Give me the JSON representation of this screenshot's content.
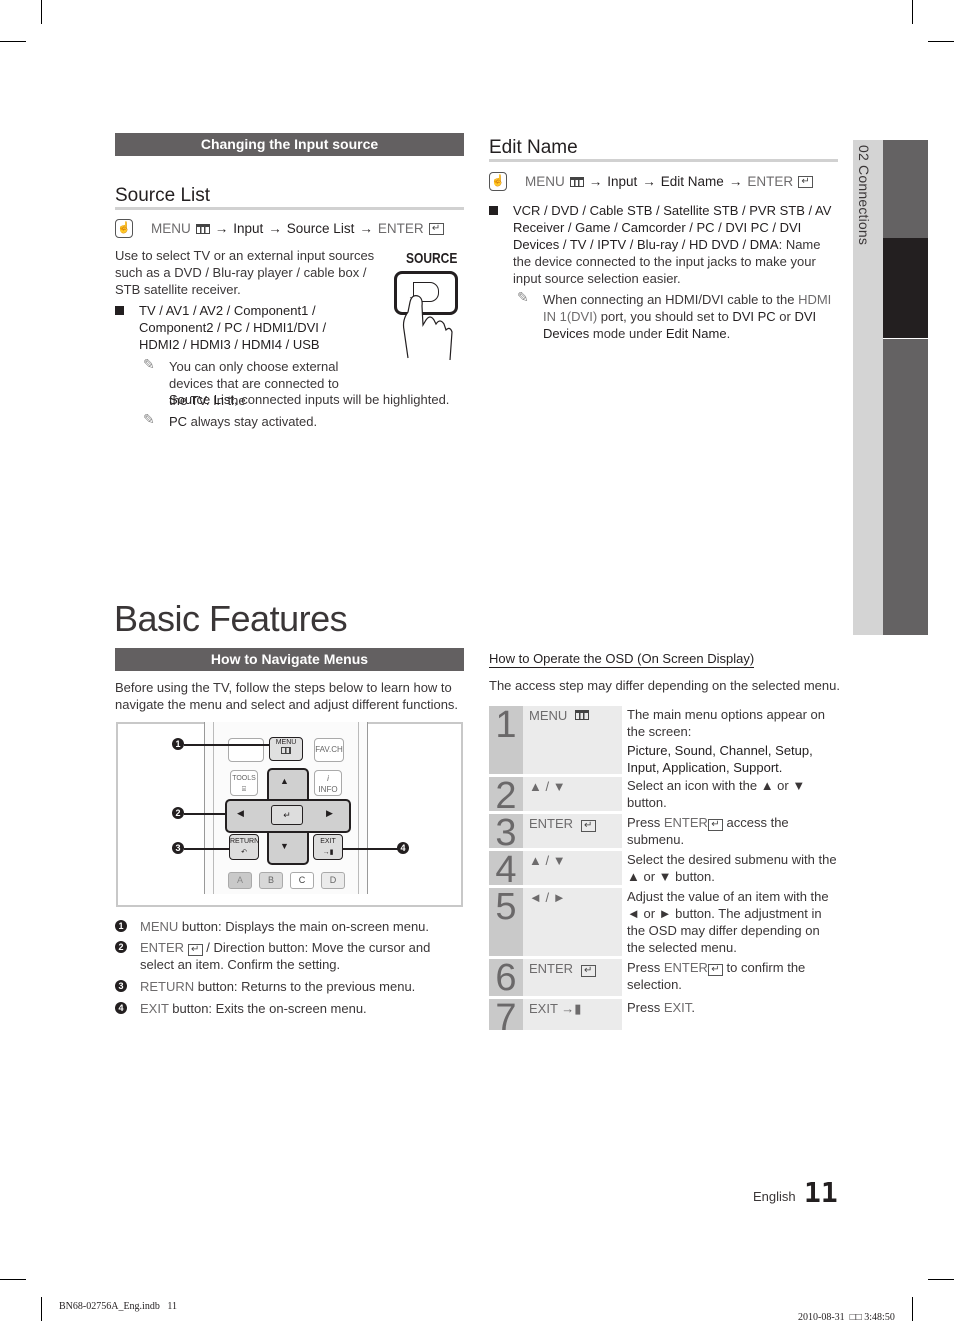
{
  "page": {
    "language": "English",
    "page_number": "11",
    "side_tab_label": "02  Connections"
  },
  "changing_input": {
    "header": "Changing the Input source",
    "source_list": {
      "title": "Source List",
      "path": {
        "menu": "MENU",
        "input": "Input",
        "item": "Source List",
        "enter": "ENTER"
      },
      "description": "Use to select TV or an external input sources such as a DVD / Blu-ray player / cable box / STB satellite receiver.",
      "button_label": "SOURCE",
      "bullet": "TV / AV1 / AV2 / Component1 / Component2 / PC / HDMI1/DVI / HDMI2 / HDMI3 / HDMI4 / USB",
      "note1_a": "You can only choose external devices that are connected to the TV. In the ",
      "note1_bold": "Source List",
      "note1_b": ", connected inputs will be highlighted.",
      "note2_bold": "PC",
      "note2_rest": " always stay activated."
    }
  },
  "edit_name": {
    "title": "Edit Name",
    "path": {
      "menu": "MENU",
      "input": "Input",
      "item": "Edit Name",
      "enter": "ENTER"
    },
    "bullet_bold": "VCR / DVD / Cable STB / Satellite STB / PVR STB / AV Receiver / Game / Camcorder / PC / DVI PC / DVI Devices / TV / IPTV / Blu-ray / HD DVD / DMA",
    "bullet_rest": ": Name the device connected to the input jacks to make your input source selection easier.",
    "note_a": "When connecting an HDMI/DVI cable to the ",
    "note_port": "HDMI IN 1(DVI)",
    "note_b": " port, you should set to ",
    "note_bold1": "DVI PC",
    "note_c": " or ",
    "note_bold2": "DVI Devices",
    "note_d": " mode under ",
    "note_bold3": "Edit Name",
    "note_e": "."
  },
  "basic_features": {
    "title": "Basic Features",
    "navigate": {
      "header": "How to Navigate Menus",
      "intro": "Before using the TV, follow the steps below to learn how to navigate the menu and select and adjust different functions.",
      "remote": {
        "menu": "MENU",
        "favch": "FAV.CH",
        "tools": "TOOLS",
        "info": "INFO",
        "return": "RETURN",
        "exit": "EXIT",
        "colors": [
          "A",
          "B",
          "C",
          "D"
        ],
        "callouts": [
          "1",
          "2",
          "3",
          "4"
        ]
      },
      "legend": [
        {
          "num": "1",
          "bold": "MENU",
          "text": " button: Displays the main on-screen menu."
        },
        {
          "num": "2",
          "bold": "ENTER",
          "text": " / Direction button: Move the cursor and select an item. Confirm the setting."
        },
        {
          "num": "3",
          "bold": "RETURN",
          "text": " button: Returns to the previous menu."
        },
        {
          "num": "4",
          "bold": "EXIT",
          "text": " button: Exits the on-screen menu."
        }
      ]
    },
    "osd": {
      "title": "How to Operate the OSD (On Screen Display)",
      "intro": "The access step may differ depending on the selected menu.",
      "steps": [
        {
          "num": "1",
          "key": "MENU",
          "desc": "The main menu options appear on the screen:",
          "desc_bold": "Picture, Sound, Channel, Setup, Input, Application, Support",
          "desc_end": "."
        },
        {
          "num": "2",
          "key": "▲ / ▼",
          "desc": "Select an icon with the ▲ or ▼ button."
        },
        {
          "num": "3",
          "key": "ENTER",
          "desc_pre": "Press ",
          "desc_bold": "ENTER",
          "desc": " access the submenu."
        },
        {
          "num": "4",
          "key": "▲ / ▼",
          "desc": "Select the desired submenu with the ▲ or ▼ button."
        },
        {
          "num": "5",
          "key": "◄ / ►",
          "desc": "Adjust the value of an item with the ◄ or ► button. The adjustment in the OSD may differ depending on the selected menu."
        },
        {
          "num": "6",
          "key": "ENTER",
          "desc_pre": "Press ",
          "desc_bold": "ENTER",
          "desc": " to confirm the selection."
        },
        {
          "num": "7",
          "key": "EXIT",
          "desc_pre": "Press ",
          "desc_bold": "EXIT",
          "desc": "."
        }
      ]
    }
  },
  "print_footer": {
    "file": "BN68-02756A_Eng.indb   11",
    "date": "2010-08-31",
    "garbled": "□□",
    "time": "3:48:50"
  }
}
